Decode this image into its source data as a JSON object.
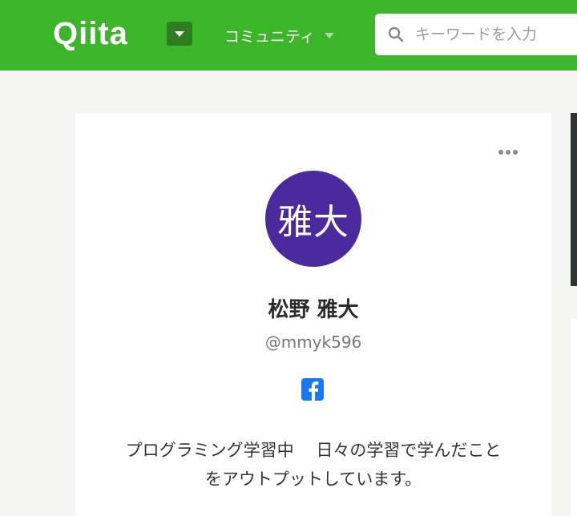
{
  "header": {
    "logo": "Qiita",
    "community_label": "コミュニティ",
    "search": {
      "placeholder": "キーワードを入力",
      "value": ""
    },
    "color": "#3db52a"
  },
  "profile": {
    "avatar_text": "雅大",
    "avatar_color": "#4a2a9c",
    "name": "松野 雅大",
    "handle": "@mmyk596",
    "social_icon": "facebook-icon",
    "bio_lines": [
      "プログラミング学習中　 日々の学習で学んだこと",
      "をアウトプットしています。"
    ]
  }
}
